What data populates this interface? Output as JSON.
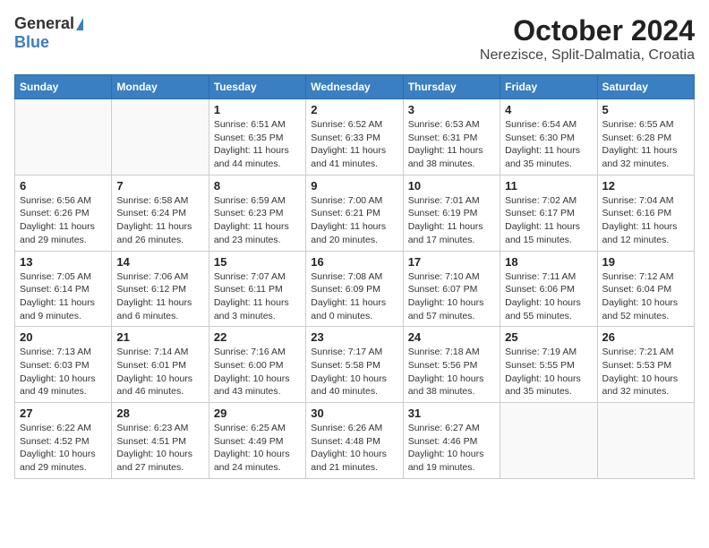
{
  "header": {
    "logo_general": "General",
    "logo_blue": "Blue",
    "title": "October 2024",
    "subtitle": "Nerezisce, Split-Dalmatia, Croatia"
  },
  "weekdays": [
    "Sunday",
    "Monday",
    "Tuesday",
    "Wednesday",
    "Thursday",
    "Friday",
    "Saturday"
  ],
  "weeks": [
    [
      {
        "day": "",
        "info": ""
      },
      {
        "day": "",
        "info": ""
      },
      {
        "day": "1",
        "info": "Sunrise: 6:51 AM\nSunset: 6:35 PM\nDaylight: 11 hours and 44 minutes."
      },
      {
        "day": "2",
        "info": "Sunrise: 6:52 AM\nSunset: 6:33 PM\nDaylight: 11 hours and 41 minutes."
      },
      {
        "day": "3",
        "info": "Sunrise: 6:53 AM\nSunset: 6:31 PM\nDaylight: 11 hours and 38 minutes."
      },
      {
        "day": "4",
        "info": "Sunrise: 6:54 AM\nSunset: 6:30 PM\nDaylight: 11 hours and 35 minutes."
      },
      {
        "day": "5",
        "info": "Sunrise: 6:55 AM\nSunset: 6:28 PM\nDaylight: 11 hours and 32 minutes."
      }
    ],
    [
      {
        "day": "6",
        "info": "Sunrise: 6:56 AM\nSunset: 6:26 PM\nDaylight: 11 hours and 29 minutes."
      },
      {
        "day": "7",
        "info": "Sunrise: 6:58 AM\nSunset: 6:24 PM\nDaylight: 11 hours and 26 minutes."
      },
      {
        "day": "8",
        "info": "Sunrise: 6:59 AM\nSunset: 6:23 PM\nDaylight: 11 hours and 23 minutes."
      },
      {
        "day": "9",
        "info": "Sunrise: 7:00 AM\nSunset: 6:21 PM\nDaylight: 11 hours and 20 minutes."
      },
      {
        "day": "10",
        "info": "Sunrise: 7:01 AM\nSunset: 6:19 PM\nDaylight: 11 hours and 17 minutes."
      },
      {
        "day": "11",
        "info": "Sunrise: 7:02 AM\nSunset: 6:17 PM\nDaylight: 11 hours and 15 minutes."
      },
      {
        "day": "12",
        "info": "Sunrise: 7:04 AM\nSunset: 6:16 PM\nDaylight: 11 hours and 12 minutes."
      }
    ],
    [
      {
        "day": "13",
        "info": "Sunrise: 7:05 AM\nSunset: 6:14 PM\nDaylight: 11 hours and 9 minutes."
      },
      {
        "day": "14",
        "info": "Sunrise: 7:06 AM\nSunset: 6:12 PM\nDaylight: 11 hours and 6 minutes."
      },
      {
        "day": "15",
        "info": "Sunrise: 7:07 AM\nSunset: 6:11 PM\nDaylight: 11 hours and 3 minutes."
      },
      {
        "day": "16",
        "info": "Sunrise: 7:08 AM\nSunset: 6:09 PM\nDaylight: 11 hours and 0 minutes."
      },
      {
        "day": "17",
        "info": "Sunrise: 7:10 AM\nSunset: 6:07 PM\nDaylight: 10 hours and 57 minutes."
      },
      {
        "day": "18",
        "info": "Sunrise: 7:11 AM\nSunset: 6:06 PM\nDaylight: 10 hours and 55 minutes."
      },
      {
        "day": "19",
        "info": "Sunrise: 7:12 AM\nSunset: 6:04 PM\nDaylight: 10 hours and 52 minutes."
      }
    ],
    [
      {
        "day": "20",
        "info": "Sunrise: 7:13 AM\nSunset: 6:03 PM\nDaylight: 10 hours and 49 minutes."
      },
      {
        "day": "21",
        "info": "Sunrise: 7:14 AM\nSunset: 6:01 PM\nDaylight: 10 hours and 46 minutes."
      },
      {
        "day": "22",
        "info": "Sunrise: 7:16 AM\nSunset: 6:00 PM\nDaylight: 10 hours and 43 minutes."
      },
      {
        "day": "23",
        "info": "Sunrise: 7:17 AM\nSunset: 5:58 PM\nDaylight: 10 hours and 40 minutes."
      },
      {
        "day": "24",
        "info": "Sunrise: 7:18 AM\nSunset: 5:56 PM\nDaylight: 10 hours and 38 minutes."
      },
      {
        "day": "25",
        "info": "Sunrise: 7:19 AM\nSunset: 5:55 PM\nDaylight: 10 hours and 35 minutes."
      },
      {
        "day": "26",
        "info": "Sunrise: 7:21 AM\nSunset: 5:53 PM\nDaylight: 10 hours and 32 minutes."
      }
    ],
    [
      {
        "day": "27",
        "info": "Sunrise: 6:22 AM\nSunset: 4:52 PM\nDaylight: 10 hours and 29 minutes."
      },
      {
        "day": "28",
        "info": "Sunrise: 6:23 AM\nSunset: 4:51 PM\nDaylight: 10 hours and 27 minutes."
      },
      {
        "day": "29",
        "info": "Sunrise: 6:25 AM\nSunset: 4:49 PM\nDaylight: 10 hours and 24 minutes."
      },
      {
        "day": "30",
        "info": "Sunrise: 6:26 AM\nSunset: 4:48 PM\nDaylight: 10 hours and 21 minutes."
      },
      {
        "day": "31",
        "info": "Sunrise: 6:27 AM\nSunset: 4:46 PM\nDaylight: 10 hours and 19 minutes."
      },
      {
        "day": "",
        "info": ""
      },
      {
        "day": "",
        "info": ""
      }
    ]
  ]
}
